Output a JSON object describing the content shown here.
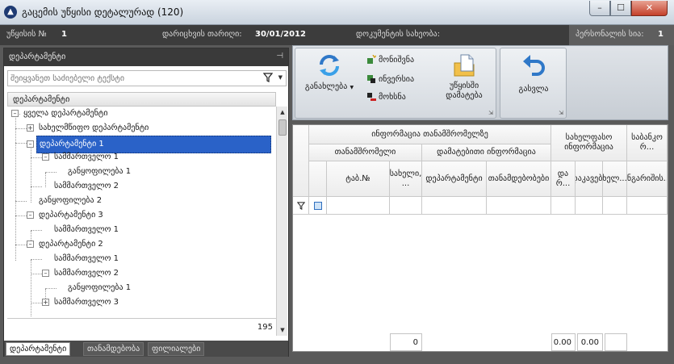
{
  "window": {
    "title": "გაცემის უწყისი დეტალურად",
    "count": "(120)",
    "min_label": "–",
    "max_label": "☐",
    "close_label": "✕",
    "app_icon_glyph": "▲"
  },
  "infobar": {
    "doc_no_label": "უწყისის №",
    "doc_no_value": "1",
    "date_label": "დარიცხვის თარიღი:",
    "date_value": "30/01/2012",
    "doc_type_label": "დოკუმენტის სახეობა:",
    "doc_type_value": "",
    "staff_label": "პერსონალის სია:",
    "staff_value": "1"
  },
  "left_panel": {
    "title": "დეპარტამენტი",
    "pin_glyph": "⊣",
    "search_placeholder": "შეიყვანეთ საძიებელი ტექსტი",
    "tree_header": "დეპარტამენტი",
    "nodes": [
      {
        "label": "ყველა დეპარტამენტი",
        "exp": "–"
      },
      {
        "label": "სახელმწიფო დეპარტამენტი",
        "exp": "+"
      },
      {
        "label": "დეპარტამენტი 1",
        "exp": "–"
      },
      {
        "label": "სამმართველო 1",
        "exp": "–"
      },
      {
        "label": "განყოფილება 1",
        "exp": ""
      },
      {
        "label": "სამმართველო 2",
        "exp": ""
      },
      {
        "label": "განყოფილება 2",
        "exp": ""
      },
      {
        "label": "დეპარტამენტი 3",
        "exp": "–"
      },
      {
        "label": "სამმართველო 1",
        "exp": ""
      },
      {
        "label": "დეპარტამენტი 2",
        "exp": "–"
      },
      {
        "label": "სამმართველო 1",
        "exp": ""
      },
      {
        "label": "სამმართველო 2",
        "exp": "–"
      },
      {
        "label": "განყოფილება 1",
        "exp": ""
      },
      {
        "label": "სამმართველო 3",
        "exp": "+"
      }
    ],
    "count": "195",
    "tabs": [
      "დეპარტამენტი",
      "თანამდებობა",
      "ფილიალები"
    ]
  },
  "ribbon": {
    "refresh_label": "განახლება",
    "select_label": "მონიშვნა",
    "invert_label": "ინვერსია",
    "remove_label": "მოხსნა",
    "add_line1": "უწყისში",
    "add_line2": "დამატება",
    "exit_label": "გასვლა",
    "launch_glyph": "⇲"
  },
  "grid": {
    "group_info": "ინფორმაცია თანამშრომელზე",
    "group_employee": "თანამშრომელი",
    "group_extra": "დამატებითი ინფორმაცია",
    "group_salary": "სახელფასო ინფორმაცია",
    "group_bank": "საბანკო რ...",
    "col_tab": "ტაბ.№",
    "col_name": "სახელი, ...",
    "col_dept": "დეპარტამენტი",
    "col_position": "თანამდებობები",
    "col_da": "და რ...",
    "col_dakav": "დაკავება",
    "col_khel": "ხელ...",
    "col_account": "ანგარიშის...",
    "footer_count": "0",
    "footer_sum1": "0.00",
    "footer_sum2": "0.00",
    "colors": {
      "selection": "#2a62c8",
      "dark_bar": "#3c3c3c"
    }
  }
}
